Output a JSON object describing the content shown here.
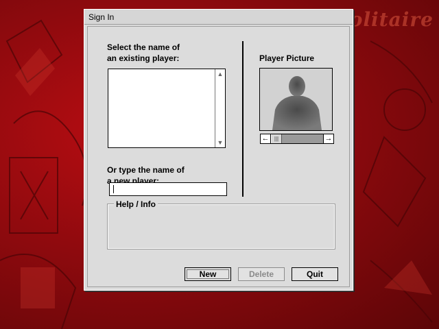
{
  "background": {
    "title": "Solitaire"
  },
  "dialog": {
    "title": "Sign In",
    "existing_label_line1": "Select the name of",
    "existing_label_line2": "an existing player:",
    "new_label_line1": "Or type the name of",
    "new_label_line2": "a new player:",
    "new_player_value": "",
    "picture_label": "Player Picture",
    "help_label": "Help / Info",
    "buttons": {
      "new": "New",
      "delete": "Delete",
      "quit": "Quit"
    }
  },
  "icons": {
    "list_up": "scroll-up-arrow",
    "list_down": "scroll-down-arrow",
    "picture_prev": "left-arrow",
    "picture_next": "right-arrow"
  }
}
